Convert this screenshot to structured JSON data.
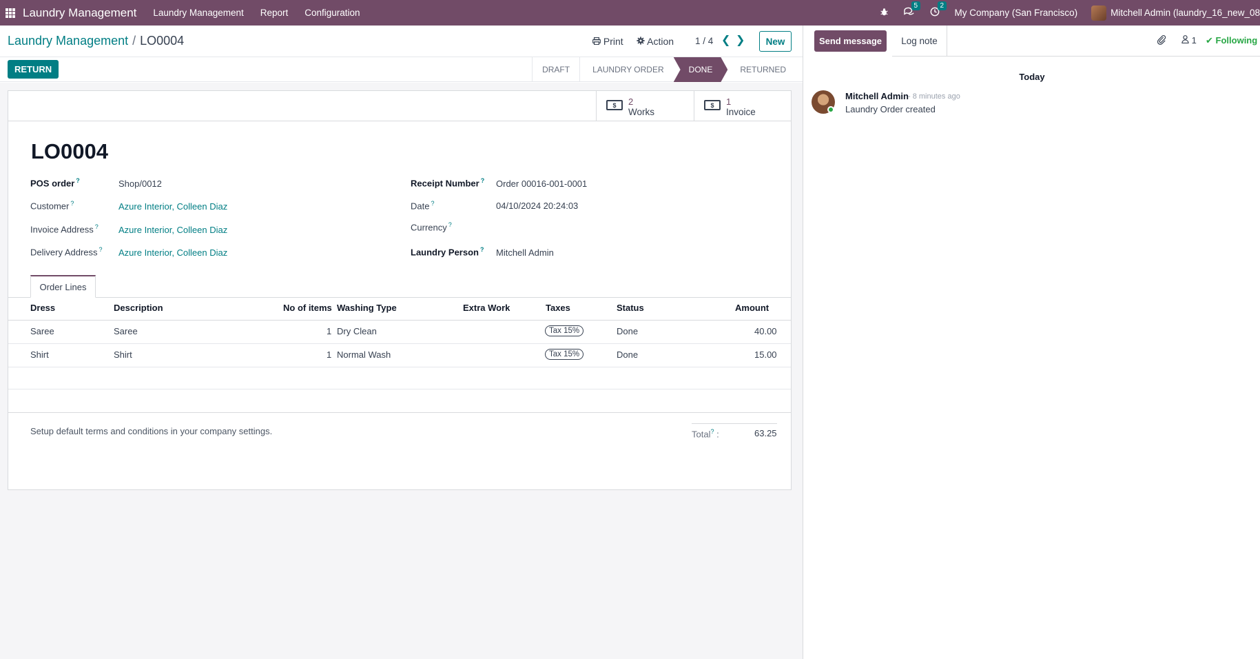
{
  "navbar": {
    "brand": "Laundry Management",
    "menu": [
      "Laundry Management",
      "Report",
      "Configuration"
    ],
    "messages_count": "5",
    "activities_count": "2",
    "company": "My Company (San Francisco)",
    "user": "Mitchell Admin (laundry_16_new_08"
  },
  "control": {
    "breadcrumb_parent": "Laundry Management",
    "breadcrumb_sep": "/",
    "breadcrumb_current": "LO0004",
    "print_label": "Print",
    "action_label": "Action",
    "pager": "1 / 4",
    "new_label": "New"
  },
  "statusbar": {
    "return_label": "RETURN",
    "stages": [
      "DRAFT",
      "LAUNDRY ORDER",
      "DONE",
      "RETURNED"
    ],
    "active_stage": "DONE"
  },
  "smart_buttons": [
    {
      "value": "2",
      "label": "Works"
    },
    {
      "value": "1",
      "label": "Invoice"
    }
  ],
  "form": {
    "title": "LO0004",
    "pos_order_label": "POS order",
    "pos_order": "Shop/0012",
    "customer_label": "Customer",
    "customer": "Azure Interior, Colleen Diaz",
    "invoice_address_label": "Invoice Address",
    "invoice_address": "Azure Interior, Colleen Diaz",
    "delivery_address_label": "Delivery Address",
    "delivery_address": "Azure Interior, Colleen Diaz",
    "receipt_label": "Receipt Number",
    "receipt": "Order 00016-001-0001",
    "date_label": "Date",
    "date": "04/10/2024 20:24:03",
    "currency_label": "Currency",
    "laundry_person_label": "Laundry Person",
    "laundry_person": "Mitchell Admin",
    "help_mark": "?"
  },
  "tabs": {
    "order_lines": "Order Lines"
  },
  "table": {
    "headers": [
      "Dress",
      "Description",
      "No of items",
      "Washing Type",
      "Extra Work",
      "Taxes",
      "Status",
      "Amount"
    ],
    "rows": [
      {
        "dress": "Saree",
        "description": "Saree",
        "items": "1",
        "washing": "Dry Clean",
        "extra": "",
        "tax": "Tax 15%",
        "status": "Done",
        "amount": "40.00"
      },
      {
        "dress": "Shirt",
        "description": "Shirt",
        "items": "1",
        "washing": "Normal Wash",
        "extra": "",
        "tax": "Tax 15%",
        "status": "Done",
        "amount": "15.00"
      }
    ]
  },
  "footer": {
    "terms": "Setup default terms and conditions in your company settings.",
    "total_label": "Total",
    "total_colon": ":",
    "total": "63.25"
  },
  "chatter": {
    "send_message": "Send message",
    "log_note": "Log note",
    "followers": "1",
    "following": "Following",
    "day": "Today",
    "author": "Mitchell Admin",
    "time": "- 8 minutes ago",
    "body": "Laundry Order created"
  },
  "colors": {
    "brand": "#714b67",
    "accent": "#017e84",
    "online": "#28a745"
  }
}
